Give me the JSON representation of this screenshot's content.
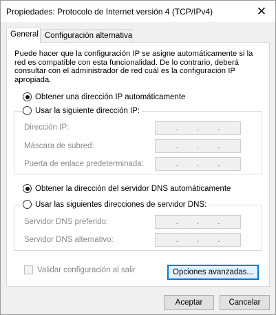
{
  "window": {
    "title": "Propiedades: Protocolo de Internet versión 4 (TCP/IPv4)",
    "close_glyph": "✕"
  },
  "tabs": [
    {
      "label": "General",
      "active": true
    },
    {
      "label": "Configuración alternativa",
      "active": false
    }
  ],
  "description": "Puede hacer que la configuración IP se asigne automáticamente si la red es compatible con esta funcionalidad. De lo contrario, deberá consultar con el administrador de red cuál es la configuración IP apropiada.",
  "ip_section": {
    "auto_label": "Obtener una dirección IP automáticamente",
    "manual_label": "Usar la siguiente dirección IP:",
    "selected": "auto",
    "fields": [
      {
        "label": "Dirección IP:",
        "value": "",
        "separator": "."
      },
      {
        "label": "Máscara de subred:",
        "value": "",
        "separator": "."
      },
      {
        "label": "Puerta de enlace predeterminada:",
        "value": "",
        "separator": "."
      }
    ]
  },
  "dns_section": {
    "auto_label": "Obtener la dirección del servidor DNS automáticamente",
    "manual_label": "Usar las siguientes direcciones de servidor DNS:",
    "selected": "auto",
    "fields": [
      {
        "label": "Servidor DNS preferido:",
        "value": "",
        "separator": "."
      },
      {
        "label": "Servidor DNS alternativo:",
        "value": "",
        "separator": "."
      }
    ]
  },
  "validate": {
    "label": "Validar configuración al salir",
    "checked": false,
    "enabled": false
  },
  "buttons": {
    "advanced": "Opciones avanzadas...",
    "accept": "Aceptar",
    "cancel": "Cancelar"
  },
  "colors": {
    "accent": "#0078d7",
    "disabled_text": "#8a8a8a"
  }
}
